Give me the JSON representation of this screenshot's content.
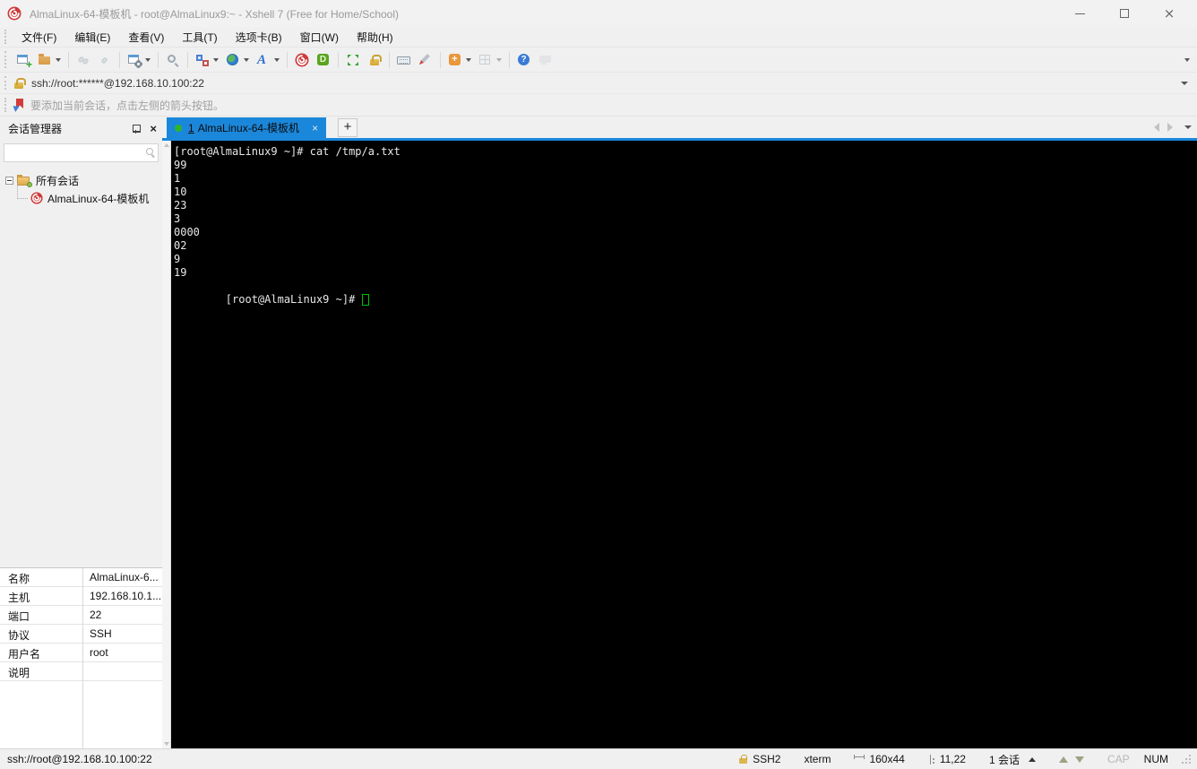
{
  "window": {
    "title": "AlmaLinux-64-模板机 - root@AlmaLinux9:~ - Xshell 7 (Free for Home/School)"
  },
  "menu_bar": {
    "items": [
      "文件(F)",
      "编辑(E)",
      "查看(V)",
      "工具(T)",
      "选项卡(B)",
      "窗口(W)",
      "帮助(H)"
    ]
  },
  "toolbar": {
    "icons": [
      "new-session",
      "open-session",
      "disconnect",
      "reconnect",
      "session-properties",
      "find",
      "compose-pane",
      "web-browser",
      "font",
      "xshell",
      "xftp",
      "fullscreen",
      "lock-screen",
      "virtual-keyboard",
      "highlighter",
      "new-file",
      "tile-layout",
      "help",
      "instant-message",
      "toolbar-overflow"
    ]
  },
  "address_bar": {
    "value": "ssh://root:******@192.168.10.100:22"
  },
  "notice_bar": {
    "text": "要添加当前会话，点击左侧的箭头按钮。"
  },
  "session_manager": {
    "title": "会话管理器",
    "tree_root": "所有会话",
    "tree_child": "AlmaLinux-64-模板机",
    "properties": [
      {
        "label": "名称",
        "value": "AlmaLinux-6..."
      },
      {
        "label": "主机",
        "value": "192.168.10.1..."
      },
      {
        "label": "端口",
        "value": "22"
      },
      {
        "label": "协议",
        "value": "SSH"
      },
      {
        "label": "用户名",
        "value": "root"
      },
      {
        "label": "说明",
        "value": ""
      }
    ]
  },
  "tab_bar": {
    "active_tab": {
      "number": "1",
      "title": "AlmaLinux-64-模板机",
      "close": "×"
    },
    "new_tab": "+"
  },
  "terminal": {
    "lines": [
      "[root@AlmaLinux9 ~]# cat /tmp/a.txt",
      "99",
      "1",
      "10",
      "23",
      "3",
      "0000",
      "02",
      "9",
      "19"
    ],
    "prompt": "[root@AlmaLinux9 ~]# "
  },
  "status_bar": {
    "connection": "ssh://root@192.168.10.100:22",
    "protocol": "SSH2",
    "terminal_type": "xterm",
    "terminal_size": "160x44",
    "cursor_position": "11,22",
    "session_count": "1 会话",
    "caps_indicator": "CAP",
    "num_indicator": "NUM"
  },
  "colors": {
    "accent_blue": "#1b87da",
    "tab_active_bg": "#1b87da",
    "terminal_bg": "#000000",
    "terminal_fg": "#e8e8e8",
    "cursor_green": "#00c200",
    "status_dot_green": "#2db52d",
    "xshell_red": "#cf3a3a",
    "chrome_bg": "#f0f0f0"
  }
}
